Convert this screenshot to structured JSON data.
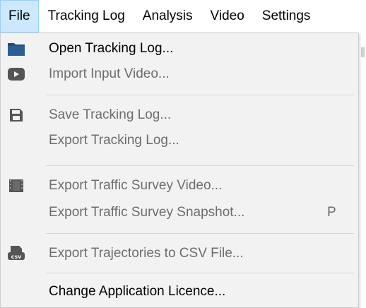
{
  "menubar": {
    "items": [
      {
        "label": "File"
      },
      {
        "label": "Tracking Log"
      },
      {
        "label": "Analysis"
      },
      {
        "label": "Video"
      },
      {
        "label": "Settings"
      }
    ]
  },
  "file_menu": {
    "items": [
      {
        "label": "Open Tracking Log...",
        "icon": "folder-icon",
        "enabled": true
      },
      {
        "label": "Import Input Video...",
        "icon": "video-play-icon",
        "enabled": false
      },
      {
        "label": "Save Tracking Log...",
        "icon": "save-icon",
        "enabled": false
      },
      {
        "label": "Export Tracking Log...",
        "icon": "",
        "enabled": false
      },
      {
        "label": "Export Traffic Survey Video...",
        "icon": "film-icon",
        "enabled": false
      },
      {
        "label": "Export Traffic Survey Snapshot...",
        "icon": "",
        "enabled": false,
        "shortcut": "P"
      },
      {
        "label": "Export Trajectories to CSV File...",
        "icon": "csv-icon",
        "enabled": false
      },
      {
        "label": "Change Application Licence...",
        "icon": "",
        "enabled": true
      }
    ]
  },
  "colors": {
    "active_menu_bg": "#cce8ff",
    "dropdown_bg": "#f2f2f2",
    "folder_icon": "#1f4e79",
    "disabled_text": "#6d6d6d"
  }
}
